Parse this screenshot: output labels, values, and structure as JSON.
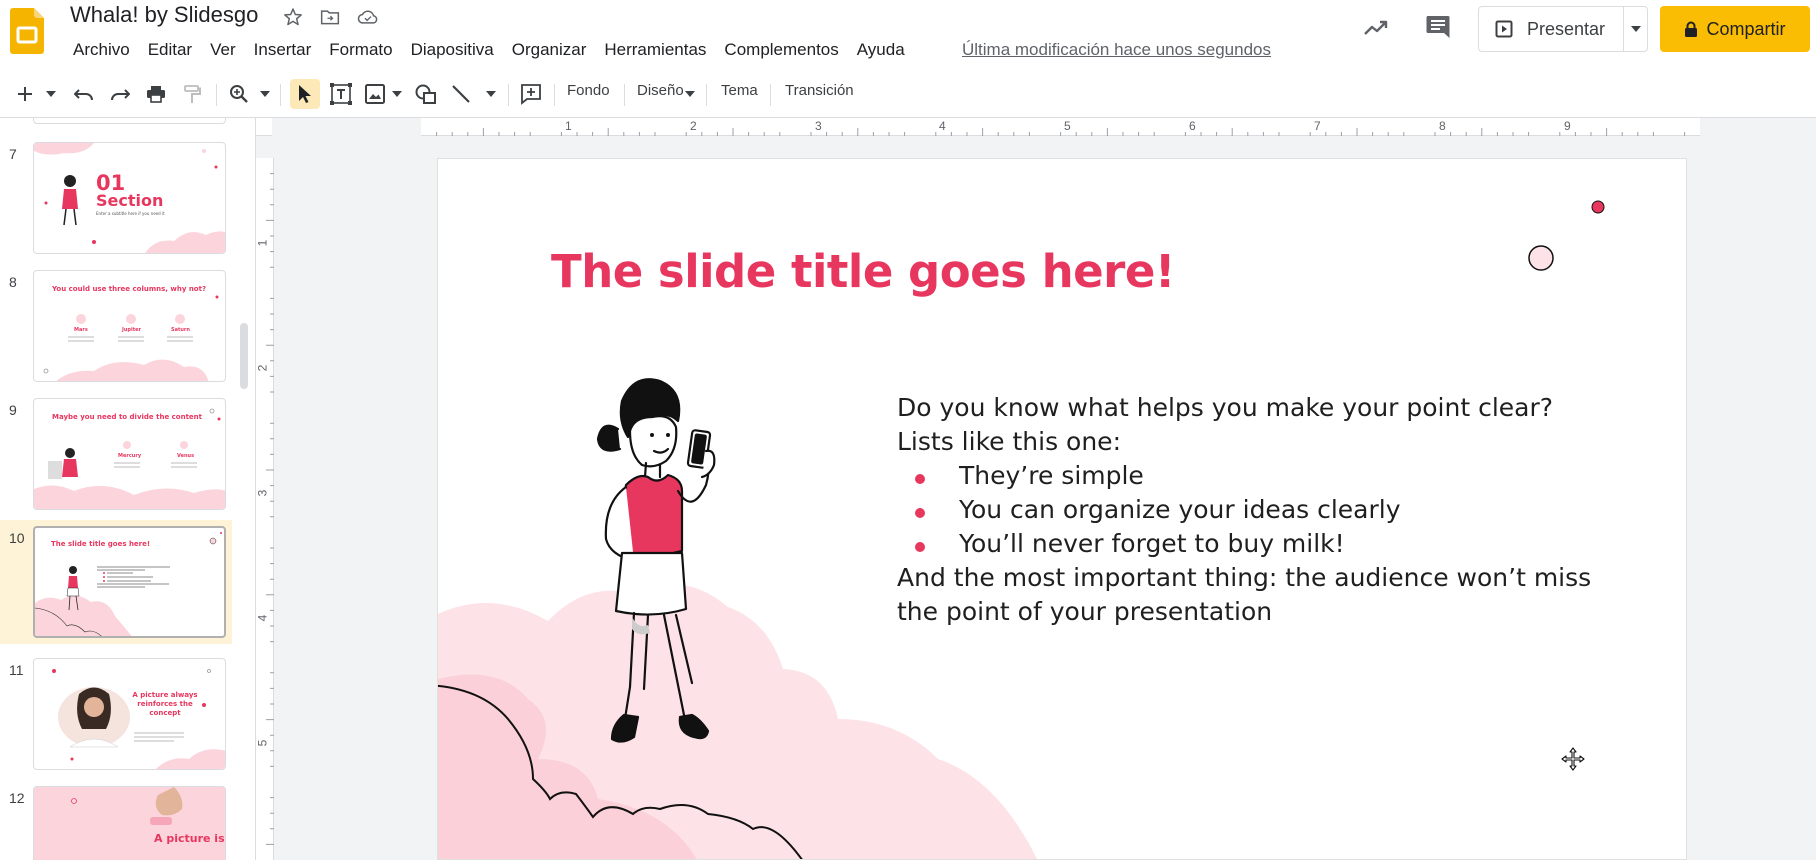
{
  "app": {
    "title": "Whala! by Slidesgo",
    "last_edit": "Última modificación hace unos segundos"
  },
  "menu": [
    "Archivo",
    "Editar",
    "Ver",
    "Insertar",
    "Formato",
    "Diapositiva",
    "Organizar",
    "Herramientas",
    "Complementos",
    "Ayuda"
  ],
  "header": {
    "present_label": "Presentar",
    "share_label": "Compartir"
  },
  "toolbar": {
    "fondo": "Fondo",
    "diseno": "Diseño",
    "tema": "Tema",
    "transicion": "Transición"
  },
  "ruler": {
    "h_labels": [
      "1",
      "2",
      "3",
      "4",
      "5",
      "6",
      "7",
      "8",
      "9"
    ],
    "v_labels": [
      "1",
      "2",
      "3",
      "4",
      "5"
    ]
  },
  "thumbnails": [
    {
      "num": "7",
      "title": "01",
      "subtitle": "Section",
      "caption": "Enter a subtitle here if you need it"
    },
    {
      "num": "8",
      "title": "You could use three columns, why not?",
      "cols": [
        "Mars",
        "Jupiter",
        "Saturn"
      ]
    },
    {
      "num": "9",
      "title": "Maybe you need to divide the content",
      "cols": [
        "Mercury",
        "Venus"
      ]
    },
    {
      "num": "10",
      "title": "The slide title goes here!"
    },
    {
      "num": "11",
      "title": "A picture always reinforces the concept"
    },
    {
      "num": "12",
      "title": "A picture is"
    }
  ],
  "selected_slide": "10",
  "slide": {
    "title": "The slide title goes here!",
    "intro1": "Do you know what helps you make your point clear?",
    "intro2": "Lists like this one:",
    "bullets": [
      "They’re simple",
      "You can organize your ideas clearly",
      "You’ll never forget to buy milk!"
    ],
    "outro": "And the most important thing: the audience won’t miss the point of your presentation"
  },
  "colors": {
    "accent_pink": "#e8375f",
    "cloud_pink": "#fbd4dc",
    "share_yellow": "#fbbc04",
    "selected_row": "#fef3d6"
  }
}
